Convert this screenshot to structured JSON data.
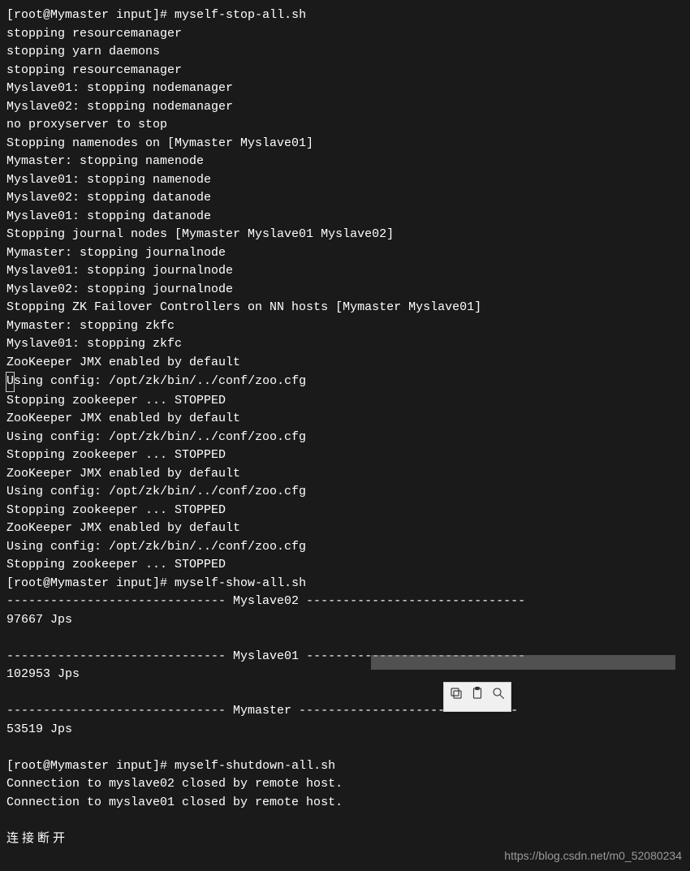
{
  "prompt1": "[root@Mymaster input]# ",
  "cmd1": "myself-stop-all.sh",
  "lines_a": [
    "stopping resourcemanager",
    "stopping yarn daemons",
    "stopping resourcemanager",
    "Myslave01: stopping nodemanager",
    "Myslave02: stopping nodemanager",
    "no proxyserver to stop",
    "Stopping namenodes on [Mymaster Myslave01]",
    "Mymaster: stopping namenode",
    "Myslave01: stopping namenode",
    "Myslave02: stopping datanode",
    "Myslave01: stopping datanode",
    "Stopping journal nodes [Mymaster Myslave01 Myslave02]",
    "Mymaster: stopping journalnode",
    "Myslave01: stopping journalnode",
    "Myslave02: stopping journalnode",
    "Stopping ZK Failover Controllers on NN hosts [Mymaster Myslave01]",
    "Mymaster: stopping zkfc",
    "Myslave01: stopping zkfc",
    "ZooKeeper JMX enabled by default"
  ],
  "cursor_char": "U",
  "line_cfg_rest": "sing config: /opt/zk/bin/../conf/zoo.cfg",
  "lines_b": [
    "Stopping zookeeper ... STOPPED",
    "ZooKeeper JMX enabled by default",
    "Using config: /opt/zk/bin/../conf/zoo.cfg",
    "Stopping zookeeper ... STOPPED",
    "ZooKeeper JMX enabled by default",
    "Using config: /opt/zk/bin/../conf/zoo.cfg",
    "Stopping zookeeper ... STOPPED",
    "ZooKeeper JMX enabled by default",
    "Using config: /opt/zk/bin/../conf/zoo.cfg",
    "Stopping zookeeper ... STOPPED"
  ],
  "cmd2": "myself-show-all.sh",
  "sep1": "------------------------------ Myslave02 ------------------------------",
  "jps1": "97667 Jps",
  "sep2_left": "------------------------------ Myslave01 ",
  "sep2_right": "------------------------------",
  "jps2": "102953 Jps",
  "sep3": "------------------------------ Mymaster ------------------------------",
  "jps3": "53519 Jps",
  "cmd3": "myself-shutdown-all.sh",
  "conn1": "Connection to myslave02 closed by remote host.",
  "conn2": "Connection to myslave01 closed by remote host.",
  "disconnect": "连接断开",
  "watermark": "https://blog.csdn.net/m0_52080234"
}
